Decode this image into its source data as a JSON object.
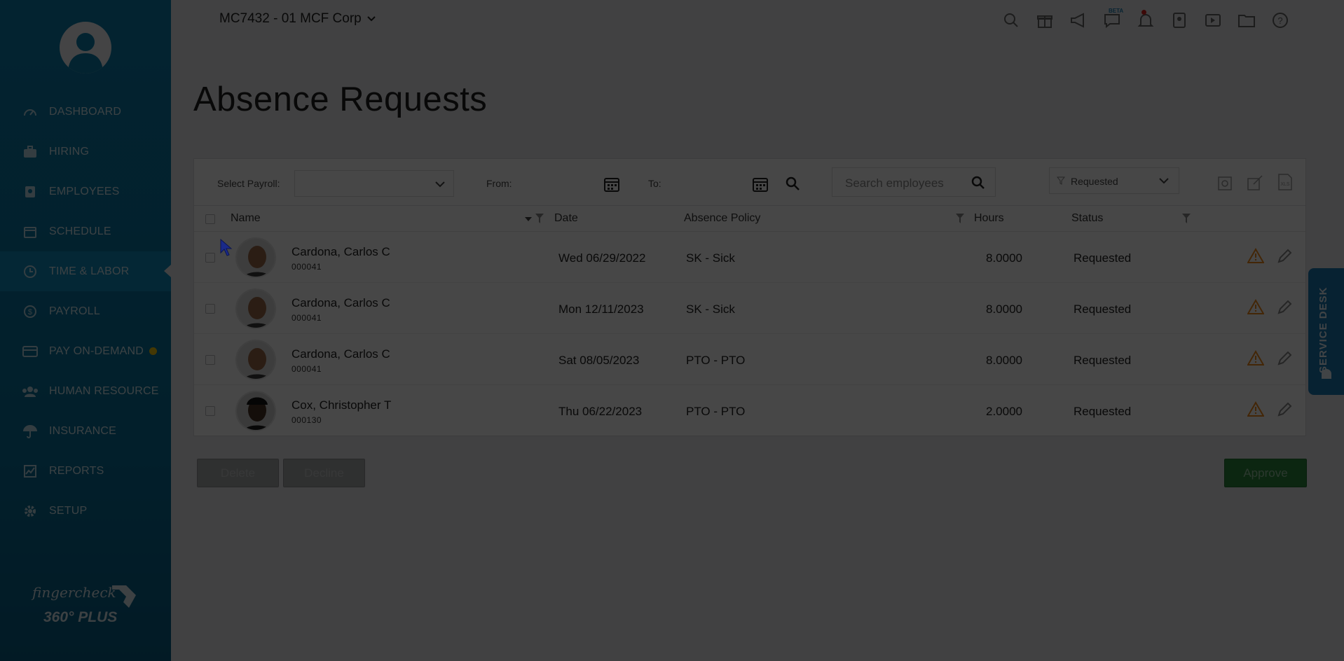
{
  "company": {
    "name": "MC7432 - 01 MCF Corp"
  },
  "sidebar": {
    "items": [
      {
        "label": "DASHBOARD",
        "icon": "dashboard-icon"
      },
      {
        "label": "HIRING",
        "icon": "briefcase-icon"
      },
      {
        "label": "EMPLOYEES",
        "icon": "id-card-icon"
      },
      {
        "label": "SCHEDULE",
        "icon": "calendar-icon"
      },
      {
        "label": "TIME & LABOR",
        "icon": "clock-icon",
        "active": true
      },
      {
        "label": "PAYROLL",
        "icon": "dollar-icon"
      },
      {
        "label": "PAY ON-DEMAND",
        "icon": "credit-card-icon",
        "dot_color": "#f2c811"
      },
      {
        "label": "HUMAN RESOURCE",
        "icon": "people-icon"
      },
      {
        "label": "INSURANCE",
        "icon": "umbrella-icon"
      },
      {
        "label": "REPORTS",
        "icon": "chart-icon"
      },
      {
        "label": "SETUP",
        "icon": "gear-icon"
      }
    ],
    "brand": {
      "name": "fingercheck",
      "tagline": "360° PLUS"
    }
  },
  "topbar": {
    "icons": [
      "search-icon",
      "gift-icon",
      "megaphone-icon",
      "chat-icon",
      "bell-icon",
      "contact-card-icon",
      "video-icon",
      "folder-icon",
      "help-icon"
    ],
    "beta_label": "BETA"
  },
  "page": {
    "title": "Absence Requests"
  },
  "filters": {
    "payroll_label": "Select Payroll:",
    "payroll_value": "",
    "from_label": "From:",
    "from_value": "",
    "to_label": "To:",
    "to_value": "",
    "search_placeholder": "Search employees",
    "status_value": "Requested"
  },
  "table": {
    "headers": {
      "name": "Name",
      "date": "Date",
      "policy": "Absence Policy",
      "hours": "Hours",
      "status": "Status"
    },
    "rows": [
      {
        "name": "Cardona, Carlos C",
        "id": "000041",
        "date": "Wed 06/29/2022",
        "policy": "SK - Sick",
        "hours": "8.0000",
        "status": "Requested"
      },
      {
        "name": "Cardona, Carlos C",
        "id": "000041",
        "date": "Mon 12/11/2023",
        "policy": "SK - Sick",
        "hours": "8.0000",
        "status": "Requested"
      },
      {
        "name": "Cardona, Carlos C",
        "id": "000041",
        "date": "Sat 08/05/2023",
        "policy": "PTO - PTO",
        "hours": "8.0000",
        "status": "Requested"
      },
      {
        "name": "Cox, Christopher T",
        "id": "000130",
        "date": "Thu 06/22/2023",
        "policy": "PTO - PTO",
        "hours": "2.0000",
        "status": "Requested"
      }
    ]
  },
  "actions": {
    "delete": "Delete",
    "decline": "Decline",
    "approve": "Approve"
  },
  "service_desk": {
    "label": "SERVICE DESK"
  },
  "colors": {
    "sidebar": "#0b7fae",
    "approve": "#2e8a3f",
    "warning": "#f08a1c",
    "overlay": "rgba(0,0,0,0.72)"
  }
}
